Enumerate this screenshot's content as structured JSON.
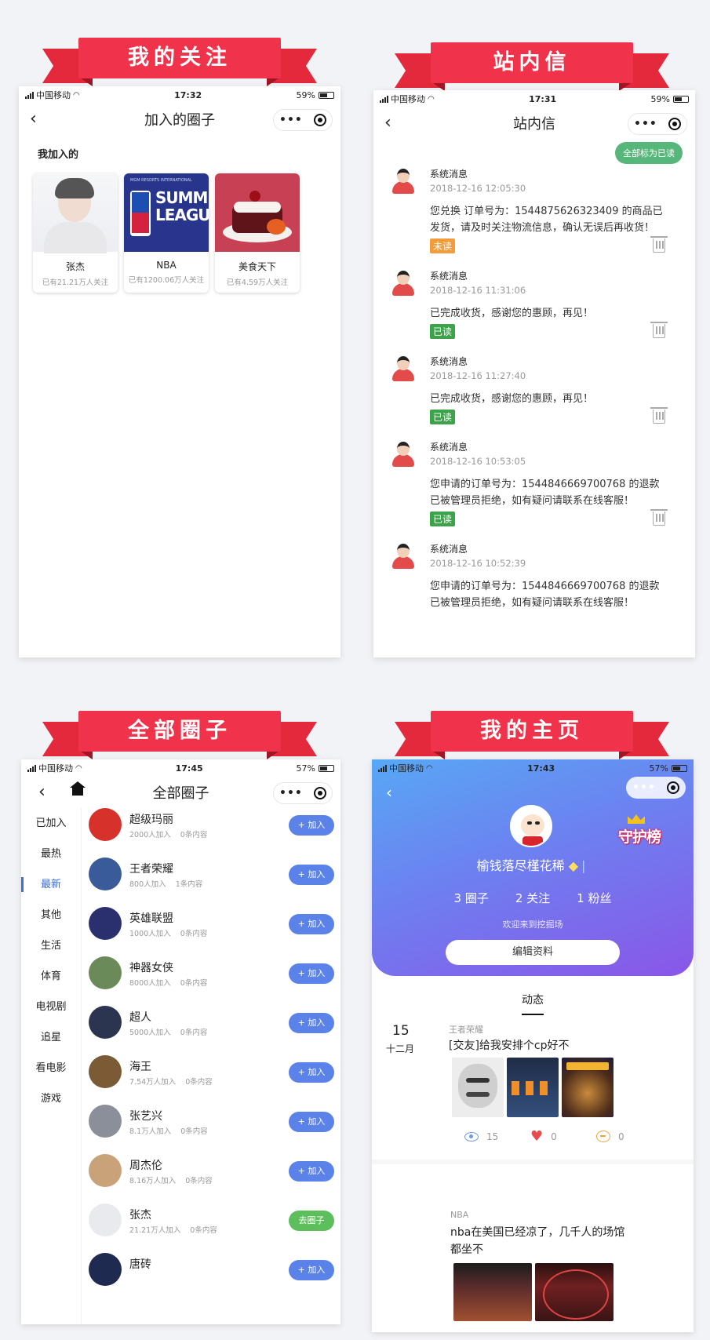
{
  "banners": {
    "p1": "我的关注",
    "p2": "站内信",
    "p3": "全部圈子",
    "p4": "我的主页"
  },
  "colors": {
    "ribbon": "#f0334a",
    "accent_blue": "#5a82e8",
    "green": "#57b77b",
    "hero_gradient": [
      "#57a8f5",
      "#8a56e8"
    ]
  },
  "p1": {
    "status": {
      "carrier": "中国移动",
      "time": "17:32",
      "battery": "59%"
    },
    "title": "加入的圈子",
    "section": "我加入的",
    "cards": [
      {
        "name": "张杰",
        "sub": "已有21.21万人关注",
        "image": "portrait-photo"
      },
      {
        "name": "NBA",
        "sub": "已有1200.06万人关注",
        "image": "nba-summer-league-logo",
        "img_small": "MGM RESORTS INTERNATIONAL",
        "img_text1": "SUMMER",
        "img_text2": "LEAGUE"
      },
      {
        "name": "美食天下",
        "sub": "已有4.59万人关注",
        "image": "cake-photo"
      }
    ]
  },
  "p2": {
    "status": {
      "carrier": "中国移动",
      "time": "17:31",
      "battery": "59%"
    },
    "title": "站内信",
    "mark_all": "全部标为已读",
    "messages": [
      {
        "sender": "系统消息",
        "time": "2018-12-16 12:05:30",
        "body": "您兑换 订单号为：1544875626323409 的商品已发货，请及时关注物流信息，确认无误后再收货！",
        "tag": "未读"
      },
      {
        "sender": "系统消息",
        "time": "2018-12-16 11:31:06",
        "body": "已完成收货，感谢您的惠顾，再见！",
        "tag": "已读"
      },
      {
        "sender": "系统消息",
        "time": "2018-12-16 11:27:40",
        "body": "已完成收货，感谢您的惠顾，再见！",
        "tag": "已读"
      },
      {
        "sender": "系统消息",
        "time": "2018-12-16 10:53:05",
        "body": "您申请的订单号为：1544846669700768 的退款已被管理员拒绝，如有疑问请联系在线客服！",
        "tag": "已读"
      },
      {
        "sender": "系统消息",
        "time": "2018-12-16 10:52:39",
        "body": "您申请的订单号为：1544846669700768 的退款已被管理员拒绝，如有疑问请联系在线客服！",
        "tag": ""
      }
    ]
  },
  "p3": {
    "status": {
      "carrier": "中国移动",
      "time": "17:45",
      "battery": "57%"
    },
    "title": "全部圈子",
    "categories": [
      "已加入",
      "最热",
      "最新",
      "其他",
      "生活",
      "体育",
      "电视剧",
      "追星",
      "看电影",
      "游戏"
    ],
    "active_category": "最新",
    "circles": [
      {
        "name": "超级玛丽",
        "members": "2000人加入",
        "posts": "0条内容",
        "btn": "+ 加入",
        "avatar_color": "#d6322b"
      },
      {
        "name": "王者荣耀",
        "members": "800人加入",
        "posts": "1条内容",
        "btn": "+ 加入",
        "avatar_color": "#3a5b9a"
      },
      {
        "name": "英雄联盟",
        "members": "1000人加入",
        "posts": "0条内容",
        "btn": "+ 加入",
        "avatar_color": "#2a2f6e"
      },
      {
        "name": "神器女侠",
        "members": "8000人加入",
        "posts": "0条内容",
        "btn": "+ 加入",
        "avatar_color": "#6b8a5a"
      },
      {
        "name": "超人",
        "members": "5000人加入",
        "posts": "0条内容",
        "btn": "+ 加入",
        "avatar_color": "#2b3550"
      },
      {
        "name": "海王",
        "members": "7.54万人加入",
        "posts": "0条内容",
        "btn": "+ 加入",
        "avatar_color": "#7a5b35"
      },
      {
        "name": "张艺兴",
        "members": "8.1万人加入",
        "posts": "0条内容",
        "btn": "+ 加入",
        "avatar_color": "#8b8f9a"
      },
      {
        "name": "周杰伦",
        "members": "8.16万人加入",
        "posts": "0条内容",
        "btn": "+ 加入",
        "avatar_color": "#c9a27a"
      },
      {
        "name": "张杰",
        "members": "21.21万人加入",
        "posts": "0条内容",
        "btn": "去圈子",
        "avatar_color": "#e9eaee"
      },
      {
        "name": "唐砖",
        "members": "",
        "posts": "",
        "btn": "+ 加入",
        "avatar_color": "#1e2a50"
      }
    ]
  },
  "p4": {
    "status": {
      "carrier": "中国移动",
      "time": "17:43",
      "battery": "57%"
    },
    "guard_label": "守护榜",
    "username": "榆钱落尽槿花稀",
    "stats": [
      "3 圈子",
      "2 关注",
      "1 粉丝"
    ],
    "welcome": "欢迎来到挖掘场",
    "edit_btn": "编辑资料",
    "tab": "动态",
    "posts": [
      {
        "day": "15",
        "month": "十二月",
        "circle": "王者荣耀",
        "text": "[交友]给我安排个cp好不",
        "views": "15",
        "likes": "0",
        "comments": "0"
      },
      {
        "circle": "NBA",
        "text": "nba在美国已经凉了，几千人的场馆都坐不"
      }
    ]
  }
}
